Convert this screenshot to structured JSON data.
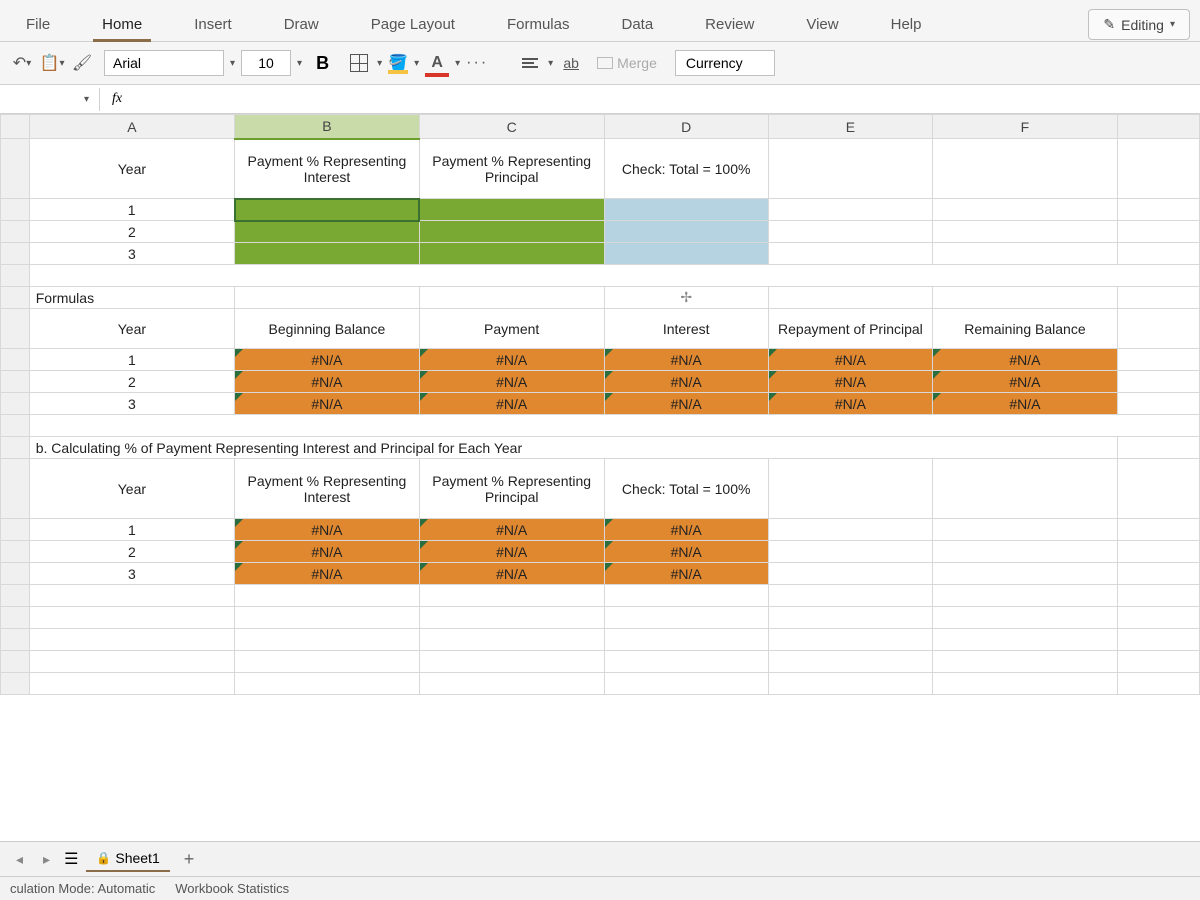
{
  "ribbon": {
    "tabs": [
      "File",
      "Home",
      "Insert",
      "Draw",
      "Page Layout",
      "Formulas",
      "Data",
      "Review",
      "View",
      "Help"
    ],
    "active": "Home",
    "editing_label": "Editing"
  },
  "toolbar": {
    "font_name": "Arial",
    "font_size": "10",
    "bold": "B",
    "merge_label": "Merge",
    "number_format": "Currency",
    "wrap_label": "ab",
    "font_color_letter": "A",
    "fill_color": "#f6c244",
    "font_color": "#d9362a"
  },
  "formula_bar": {
    "fx": "fx",
    "value": ""
  },
  "columns": [
    "A",
    "B",
    "C",
    "D",
    "E",
    "F"
  ],
  "section1": {
    "headers": {
      "a": "Year",
      "b": "Payment % Representing Interest",
      "c": "Payment % Representing Principal",
      "d": "Check: Total = 100%"
    },
    "rows": [
      "1",
      "2",
      "3"
    ]
  },
  "formulas_label": "Formulas",
  "section2": {
    "headers": {
      "a": "Year",
      "b": "Beginning Balance",
      "c": "Payment",
      "d": "Interest",
      "e": "Repayment of Principal",
      "f": "Remaining Balance"
    },
    "rows": [
      {
        "y": "1",
        "b": "#N/A",
        "c": "#N/A",
        "d": "#N/A",
        "e": "#N/A",
        "f": "#N/A"
      },
      {
        "y": "2",
        "b": "#N/A",
        "c": "#N/A",
        "d": "#N/A",
        "e": "#N/A",
        "f": "#N/A"
      },
      {
        "y": "3",
        "b": "#N/A",
        "c": "#N/A",
        "d": "#N/A",
        "e": "#N/A",
        "f": "#N/A"
      }
    ]
  },
  "section3": {
    "title": "b.  Calculating % of Payment Representing Interest and Principal for Each Year",
    "headers": {
      "a": "Year",
      "b": "Payment % Representing Interest",
      "c": "Payment % Representing Principal",
      "d": "Check: Total = 100%"
    },
    "rows": [
      {
        "y": "1",
        "b": "#N/A",
        "c": "#N/A",
        "d": "#N/A"
      },
      {
        "y": "2",
        "b": "#N/A",
        "c": "#N/A",
        "d": "#N/A"
      },
      {
        "y": "3",
        "b": "#N/A",
        "c": "#N/A",
        "d": "#N/A"
      }
    ]
  },
  "tabs": {
    "sheet": "Sheet1"
  },
  "status": {
    "calc": "culation Mode: Automatic",
    "stats": "Workbook Statistics"
  }
}
